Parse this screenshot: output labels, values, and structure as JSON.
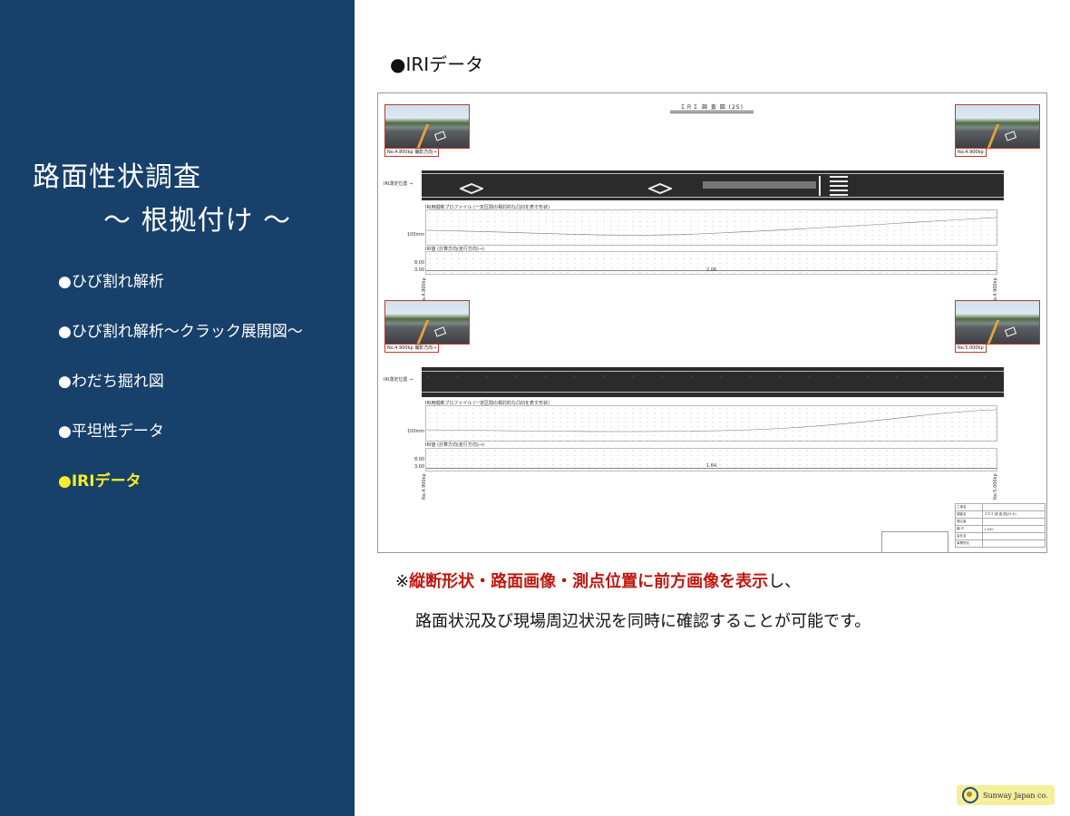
{
  "sidebar": {
    "title_line1": "路面性状調査",
    "title_line2": "～ 根拠付け ～",
    "items": [
      {
        "label": "●ひび割れ解析"
      },
      {
        "label": "●ひび割れ解析～クラック展開図～"
      },
      {
        "label": "●わだち掘れ図"
      },
      {
        "label": "●平坦性データ"
      },
      {
        "label": "●IRIデータ"
      }
    ]
  },
  "main": {
    "heading": "●IRIデータ",
    "figure": {
      "title": "ＩＲＩ 調 査 図 (25)",
      "photos": [
        {
          "caption": "No.4.800kp  撮影方向→"
        },
        {
          "caption": "No.4.900kp"
        },
        {
          "caption": "No.4.900kp  撮影方向→"
        },
        {
          "caption": "No.5.000kp"
        }
      ],
      "sections": [
        {
          "road_label": "IRI測定位置 →",
          "profile_label": "IRI用縦断プロファイル (一定区間の相対的な凸凹を表す形状)",
          "profile_scale": "100mm",
          "value_label": "IRI値 (計算方向(走行方向)→)",
          "axis_top": "8.00",
          "axis_bottom": "3.00",
          "iri_value": "2.06",
          "start_kp": "No.4.800kp",
          "end_kp": "No.4.900kp"
        },
        {
          "road_label": "IRI測定位置 →",
          "profile_label": "IRI用縦断プロファイル (一定区間の相対的な凸凹を表す形状)",
          "profile_scale": "100mm",
          "value_label": "IRI値 (計算方向(走行方向)→)",
          "axis_top": "8.00",
          "axis_bottom": "3.00",
          "iri_value": "1.64",
          "start_kp": "No.4.900kp",
          "end_kp": "No.5.000kp"
        }
      ],
      "title_block": {
        "rows": [
          [
            "工事名",
            ""
          ],
          [
            "調査名",
            "ＩＲＩ 調 査 図(25-H)"
          ],
          [
            "発注者",
            ""
          ],
          [
            "縮 尺",
            "1:200"
          ],
          [
            "会社名",
            ""
          ],
          [
            "事業所名",
            ""
          ]
        ]
      }
    },
    "note": {
      "prefix": "※",
      "emphasis": "縦断形状・路面画像・測点位置に前方画像を表示",
      "suffix": "し、",
      "line2": "路面状況及び現場周辺状況を同時に確認することが可能です。"
    }
  },
  "logo": {
    "text": "Sunway Japan co."
  },
  "colors": {
    "sidebar_bg": "#17406a",
    "active_item": "#f6ec2b",
    "emphasis": "#c0170f"
  }
}
